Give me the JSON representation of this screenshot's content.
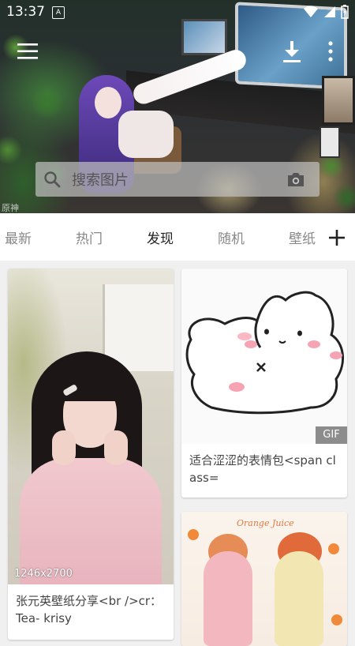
{
  "status_bar": {
    "time": "13:37",
    "notification_glyph": "A",
    "icons": [
      "wifi-icon",
      "signal-icon",
      "battery-charging-icon"
    ]
  },
  "header": {
    "menu_icon": "menu-icon",
    "download_icon": "download-icon",
    "more_icon": "more-vertical-icon",
    "watermark_text": "原神"
  },
  "search": {
    "placeholder": "搜索图片",
    "search_icon": "search-icon",
    "camera_icon": "camera-icon"
  },
  "tabs": {
    "items": [
      {
        "label": "最新",
        "active": false
      },
      {
        "label": "热门",
        "active": false
      },
      {
        "label": "发现",
        "active": true
      },
      {
        "label": "随机",
        "active": false
      },
      {
        "label": "壁纸",
        "active": false
      }
    ],
    "add_icon": "plus-icon"
  },
  "feed": {
    "cards": [
      {
        "badge": "1246x2700",
        "caption": "张元英壁纸分享<br />cr：Tea- krisy"
      },
      {
        "badge": "GIF",
        "caption": "适合涩涩的表情包<span class="
      },
      {
        "badge": "",
        "caption": "",
        "image_text": "Orange Juice"
      }
    ]
  },
  "colors": {
    "active_tab": "#222222",
    "inactive_tab": "#888888",
    "background": "#f0f0f0",
    "card": "#ffffff"
  }
}
